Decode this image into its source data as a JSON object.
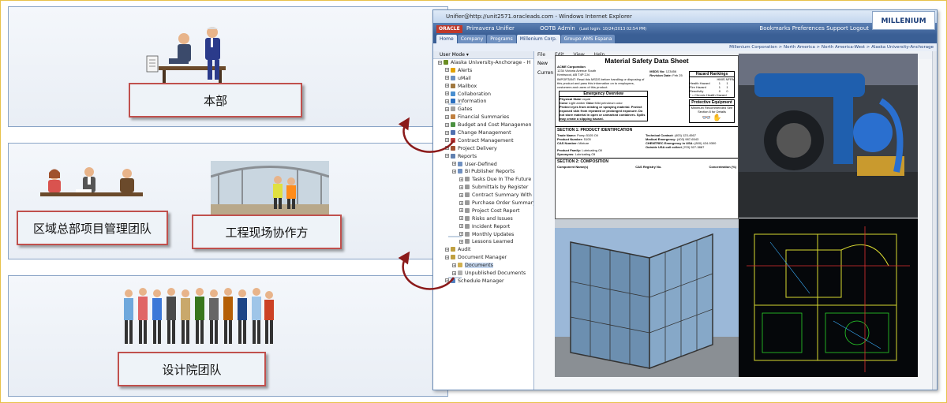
{
  "panels": {
    "headquarters": {
      "label": "本部"
    },
    "regional": {
      "label": "区域总部项目管理团队"
    },
    "site": {
      "label": "工程现场协作方"
    },
    "design": {
      "label": "设计院团队"
    }
  },
  "browser": {
    "title": "Unifier@http://unit2571.oracleads.com - Windows Internet Explorer",
    "app_name": "Primavera Unifier",
    "oracle": "ORACLE",
    "user": "OOTB Admin",
    "last_login": "(Last login: 10/24/2013 02:54 PM)",
    "links": "Bookmarks  Preferences  Support  Logout",
    "brand": "MILLENIUM",
    "tabs": [
      "Home",
      "Company",
      "Programs",
      "Millenium Corp.",
      "Groupo AMS Espana"
    ],
    "breadcrumb": "Millenium Corporation > North America > North America-West > Alaska University-Anchorage",
    "user_mode": "User Mode ▾",
    "menu": [
      "File",
      "Edit",
      "View",
      "Help"
    ],
    "new_button": "New",
    "current_label": "Curren",
    "tree": [
      {
        "label": "Alaska University-Anchorage - H",
        "level": 0,
        "color": "#6b8e23"
      },
      {
        "label": "Alerts",
        "level": 1,
        "color": "#e2a200"
      },
      {
        "label": "uMail",
        "level": 1,
        "color": "#6a8fc0"
      },
      {
        "label": "Mailbox",
        "level": 1,
        "color": "#a07840"
      },
      {
        "label": "Collaboration",
        "level": 1,
        "color": "#4a8fd0"
      },
      {
        "label": "Information",
        "level": 1,
        "color": "#2a6fc0"
      },
      {
        "label": "Gates",
        "level": 1,
        "color": "#a0a0a0"
      },
      {
        "label": "Financial Summaries",
        "level": 1,
        "color": "#c08040"
      },
      {
        "label": "Budget and Cost Managemen",
        "level": 1,
        "color": "#4a9040"
      },
      {
        "label": "Change Management",
        "level": 1,
        "color": "#5070b0"
      },
      {
        "label": "Contract Management",
        "level": 1,
        "color": "#c04040"
      },
      {
        "label": "Project Delivery",
        "level": 1,
        "color": "#a05030"
      },
      {
        "label": "Reports",
        "level": 1,
        "color": "#6080b0"
      },
      {
        "label": "User-Defined",
        "level": 2,
        "color": "#7090c0"
      },
      {
        "label": "BI Publisher Reports",
        "level": 2,
        "color": "#7090c0"
      },
      {
        "label": "Tasks Due In The Future",
        "level": 3,
        "color": "#999"
      },
      {
        "label": "Submittals by Register",
        "level": 3,
        "color": "#999"
      },
      {
        "label": "Contract Summary With Ac",
        "level": 3,
        "color": "#999"
      },
      {
        "label": "Purchase Order Summary",
        "level": 3,
        "color": "#999"
      },
      {
        "label": "Project Cost Report",
        "level": 3,
        "color": "#999"
      },
      {
        "label": "Risks and Issues",
        "level": 3,
        "color": "#999"
      },
      {
        "label": "Incident Report",
        "level": 3,
        "color": "#999"
      },
      {
        "label": "Monthly Updates",
        "level": 3,
        "color": "#999"
      },
      {
        "label": "Lessons Learned",
        "level": 3,
        "color": "#999"
      },
      {
        "label": "Audit",
        "level": 1,
        "color": "#c0a040"
      },
      {
        "label": "Document Manager",
        "level": 1,
        "color": "#c0a040"
      },
      {
        "label": "Documents",
        "level": 2,
        "color": "#d0b050",
        "selected": true
      },
      {
        "label": "Unpublished Documents",
        "level": 2,
        "color": "#b0b0b0"
      },
      {
        "label": "Schedule Manager",
        "level": 1,
        "color": "#5080c0"
      }
    ]
  },
  "msds": {
    "title": "Material Safety Data Sheet",
    "company": "ACME Corporation",
    "address1": "1234 Victoria Avenue South",
    "address2": "Kentwood, AB T4P 2J4",
    "msds_no_label": "MSDS No:",
    "msds_no": "123456",
    "revision_label": "Revision Date:",
    "revision": "Feb 25",
    "important": "IMPORTANT: Read this MSDS before handling or disposing of this product and pass this information on to employees, customers and users of this product.",
    "hazard_title": "Hazard Rankings",
    "hazard_cols": "HMIS  NFPA",
    "hazard_rows": [
      {
        "name": "Health Hazard",
        "hmis": "1",
        "nfpa": "1"
      },
      {
        "name": "Fire Hazard",
        "hmis": "1",
        "nfpa": "1"
      },
      {
        "name": "Reactivity",
        "hmis": "0",
        "nfpa": "0"
      }
    ],
    "chronic_note": "* = Chronic Health Hazard",
    "emergency_title": "Emergency Overview",
    "physical_state_label": "Physical State",
    "physical_state": "Liquid",
    "color_label": "Color",
    "color": "Light amber",
    "odor_label": "Odor",
    "odor": "Mild petroleum odor",
    "emergency_text": "Protect eyes from misting or spraying material. Protect exposed skin from repeated or prolonged exposure. Do not store material in open or unmarked containers. Spills may create a slipping hazard.",
    "protective_title": "Protective Equipment",
    "protective_sub": "Minimum Recommended See Section 8 for Details",
    "section1": "SECTION 1: PRODUCT IDENTIFICATION",
    "trade_name_label": "Trade Name:",
    "trade_name": "Pump 5105 Oil",
    "product_number_label": "Product Number:",
    "product_number": "5105",
    "cas_label": "CAS Number:",
    "cas": "Mixture",
    "technical_label": "Technical Contact:",
    "technical": "(403) 123-4567",
    "medical_label": "Medical Emergency:",
    "medical": "(403) 987-6543",
    "chemtrec_label": "CHEMTREC Emergency in USA:",
    "chemtrec": "(800) 424-9300",
    "outside_label": "Outside USA call collect",
    "outside": "(703) 527-3887",
    "family_label": "Product Family:",
    "family": "Lubricating Oil",
    "synonyms_label": "Synonyms:",
    "synonyms": "Lubricating Oil",
    "section2": "SECTION 2: COMPOSITION",
    "component_label": "Component Name(s)",
    "cas_registry_label": "CAS Registry No.",
    "concentration_label": "Concentration (%)"
  }
}
